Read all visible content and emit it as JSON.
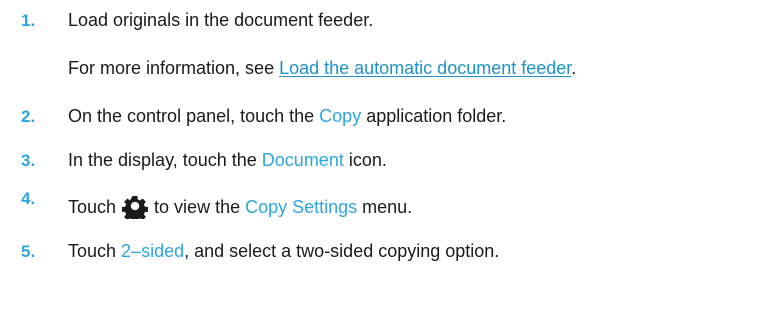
{
  "steps": [
    {
      "number": "1.",
      "text": "Load originals in the document feeder."
    },
    {
      "number": "2.",
      "pre": "On the control panel, touch the ",
      "term": "Copy",
      "post": " application folder."
    },
    {
      "number": "3.",
      "pre": "In the display, touch the ",
      "term": "Document",
      "post": " icon."
    },
    {
      "number": "4.",
      "pre": "Touch",
      "icon": "gear-icon",
      "mid": "to view the ",
      "term": "Copy Settings",
      "post": " menu."
    },
    {
      "number": "5.",
      "pre": "Touch ",
      "term": "2–sided",
      "post": ", and select a two-sided copying option."
    }
  ],
  "more_info": {
    "prefix": "For more information, see ",
    "link": "Load the automatic document feeder",
    "suffix": "."
  },
  "colors": {
    "accent": "#2da6df",
    "link": "#1f92c9",
    "text": "#1a1a1a"
  }
}
